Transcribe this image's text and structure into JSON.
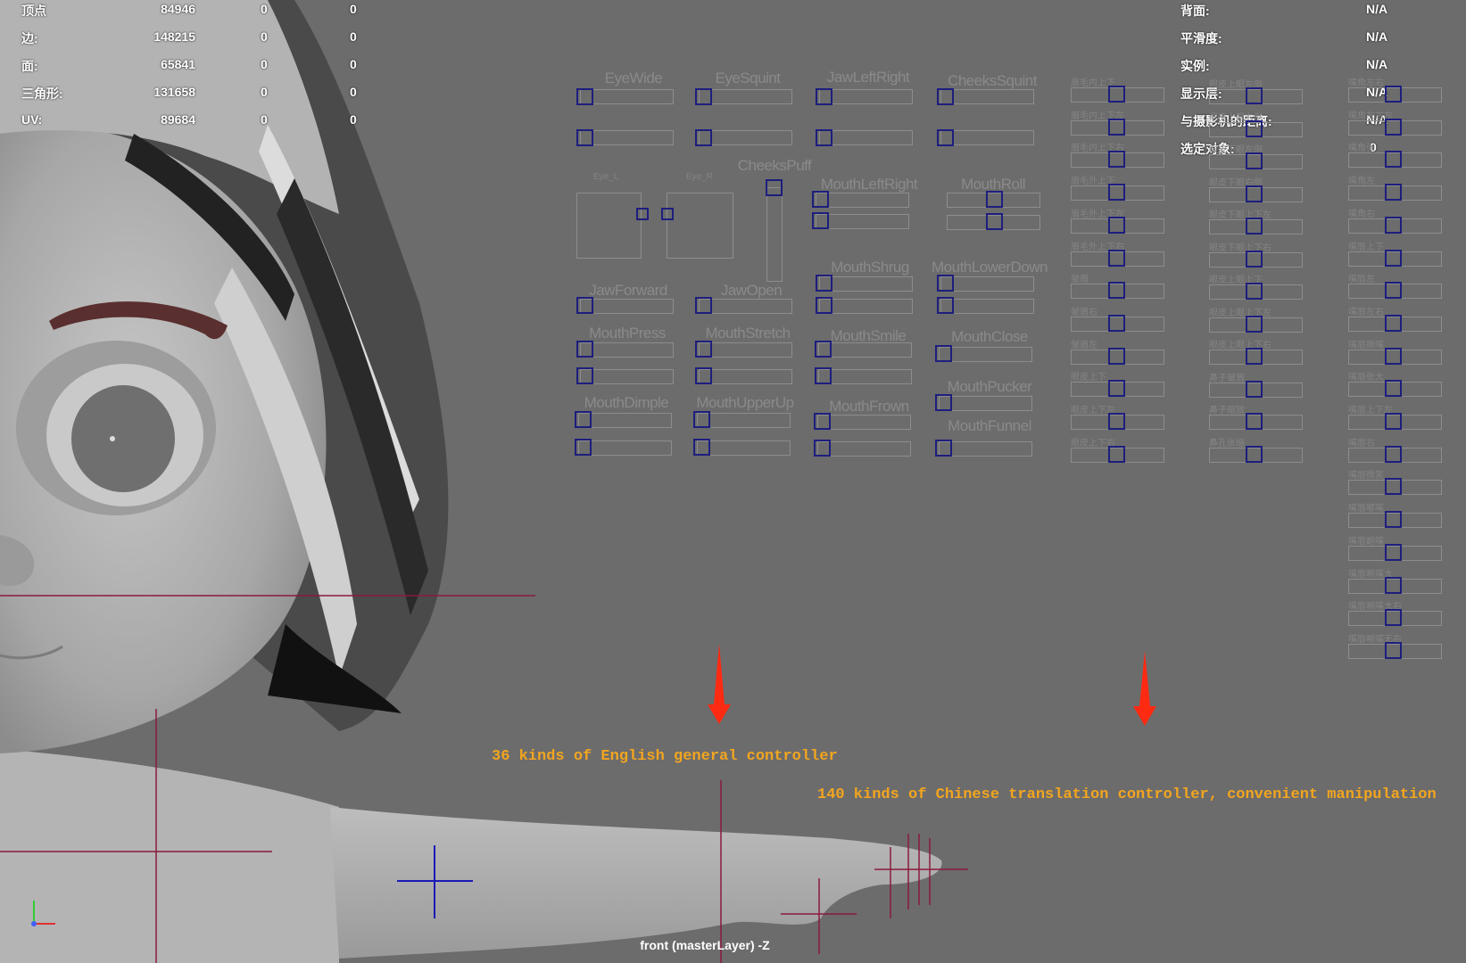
{
  "hud_left": {
    "rows": [
      {
        "label": "顶点",
        "count": "84946",
        "a": "0",
        "b": "0"
      },
      {
        "label": "边:",
        "count": "148215",
        "a": "0",
        "b": "0"
      },
      {
        "label": "面:",
        "count": "65841",
        "a": "0",
        "b": "0"
      },
      {
        "label": "三角形:",
        "count": "131658",
        "a": "0",
        "b": "0"
      },
      {
        "label": "UV:",
        "count": "89684",
        "a": "0",
        "b": "0"
      }
    ]
  },
  "hud_right": {
    "rows": [
      {
        "label": "背面:",
        "value": "N/A"
      },
      {
        "label": "平滑度:",
        "value": "N/A"
      },
      {
        "label": "实例:",
        "value": "N/A"
      },
      {
        "label": "显示层:",
        "value": "N/A"
      },
      {
        "label": "与摄影机的距离:",
        "value": "N/A"
      },
      {
        "label": "选定对象:",
        "value": "0"
      }
    ]
  },
  "face_panel": {
    "titles": {
      "eye_wide": "EyeWide",
      "eye_squint": "EyeSquint",
      "jaw_left_right": "JawLeftRight",
      "cheeks_squint": "CheeksSquint",
      "eye_l": "Eye_L",
      "eye_r": "Eye_R",
      "cheeks_puff": "CheeksPuff",
      "mouth_left_right": "MouthLeftRight",
      "mouth_roll": "MouthRoll",
      "mouth_shrug": "MouthShrug",
      "mouth_lower_down": "MouthLowerDown",
      "jaw_forward": "JawForward",
      "jaw_open": "JawOpen",
      "mouth_press": "MouthPress",
      "mouth_stretch": "MouthStretch",
      "mouth_smile": "MouthSmile",
      "mouth_close": "MouthClose",
      "mouth_pucker": "MouthPucker",
      "mouth_dimple": "MouthDimple",
      "mouth_upper_up": "MouthUpperUp",
      "mouth_frown": "MouthFrown",
      "mouth_funnel": "MouthFunnel"
    },
    "chinese_col1": [
      "眉毛内上下",
      "眉毛内上下左",
      "眉毛内上下右",
      "眉毛外上下",
      "眉毛外上下左",
      "眉毛外上下右",
      "皱眉",
      "皱眉右",
      "皱眉左",
      "眼皮上下",
      "眼皮上下左",
      "眼皮上下右"
    ],
    "chinese_col2": [
      "眼皮上眼左侧",
      "眼皮上眼右侧",
      "眼皮下眼左侧",
      "眼皮下眼右侧",
      "眼皮下眼上下左",
      "眼皮下眼上下右",
      "眼皮上眼上下",
      "眼皮上眼上下左",
      "眼皮上眼上下右",
      "鼻子皱眉",
      "鼻子缩放",
      "鼻孔张缩"
    ],
    "chinese_col3": [
      "嘴角左右",
      "嘴角左右左",
      "嘴角张",
      "嘴角左",
      "嘴角右",
      "嘴唇上下",
      "嘴唇左",
      "嘴唇左右",
      "嘴唇撅嘴",
      "嘴唇张大",
      "嘴唇上下左",
      "嘴唇右",
      "嘴唇微笑",
      "嘴唇嘟嘴",
      "嘴唇翻嘴",
      "嘴唇噘嘴大",
      "嘴唇噘嘴大右",
      "嘴唇噘嘴无右"
    ]
  },
  "annotations": {
    "english": "36 kinds of English general controller",
    "chinese": "140 kinds of Chinese translation controller, convenient manipulation"
  },
  "viewport_label": "front (masterLayer) -Z",
  "colors": {
    "background": "#6c6c6c",
    "knob": "#1e1e7e",
    "annotation": "#f2a51f",
    "arrow": "#ff2a12",
    "crosshair_red": "#8a1a3c",
    "crosshair_blue": "#1a1ab8"
  }
}
